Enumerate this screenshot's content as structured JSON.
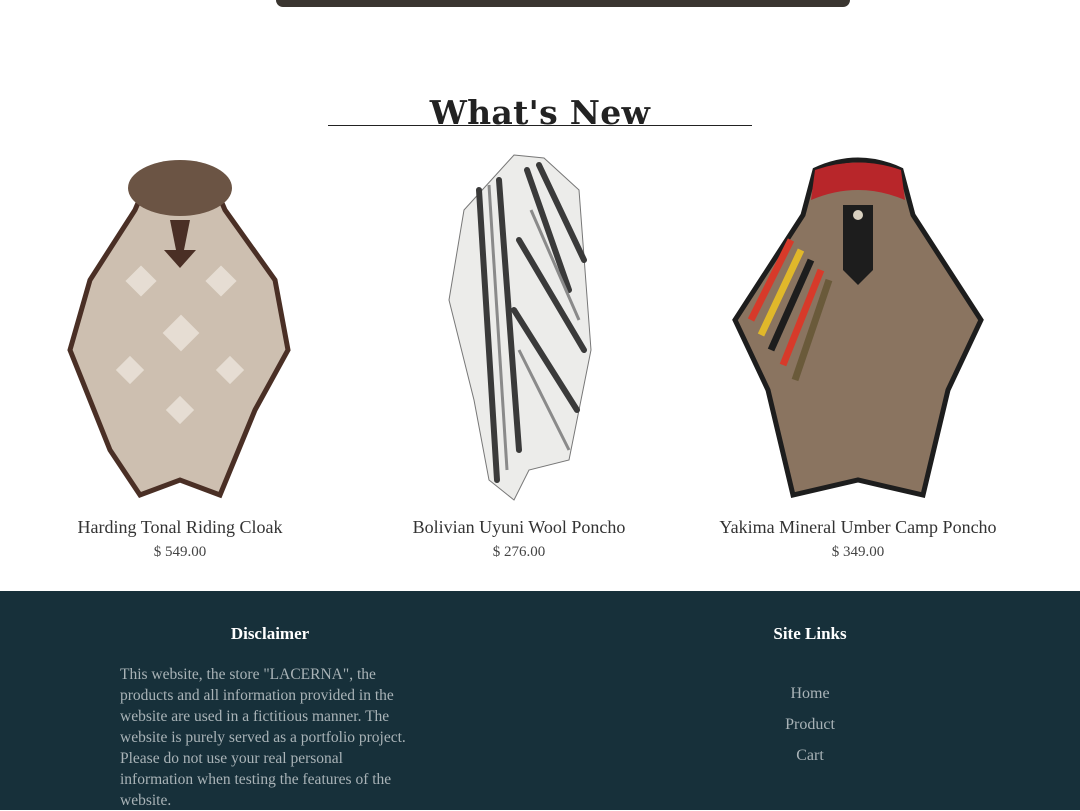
{
  "section": {
    "title": "What's New"
  },
  "products": [
    {
      "name": "Harding Tonal Riding Cloak",
      "price": "$ 549.00"
    },
    {
      "name": "Bolivian Uyuni Wool Poncho",
      "price": "$ 276.00"
    },
    {
      "name": "Yakima Mineral Umber Camp Poncho",
      "price": "$ 349.00"
    }
  ],
  "footer": {
    "disclaimer_title": "Disclaimer",
    "disclaimer_text": "This website, the store \"LACERNA\", the products and all information provided in the website are used in a fictitious manner. The website is purely served as a portfolio project. Please do not use your real personal information when testing the features of the website.",
    "links_title": "Site Links",
    "links": [
      "Home",
      "Product",
      "Cart"
    ]
  },
  "colors": {
    "footer_bg": "#17303a",
    "footer_text": "#a9b3b7"
  }
}
